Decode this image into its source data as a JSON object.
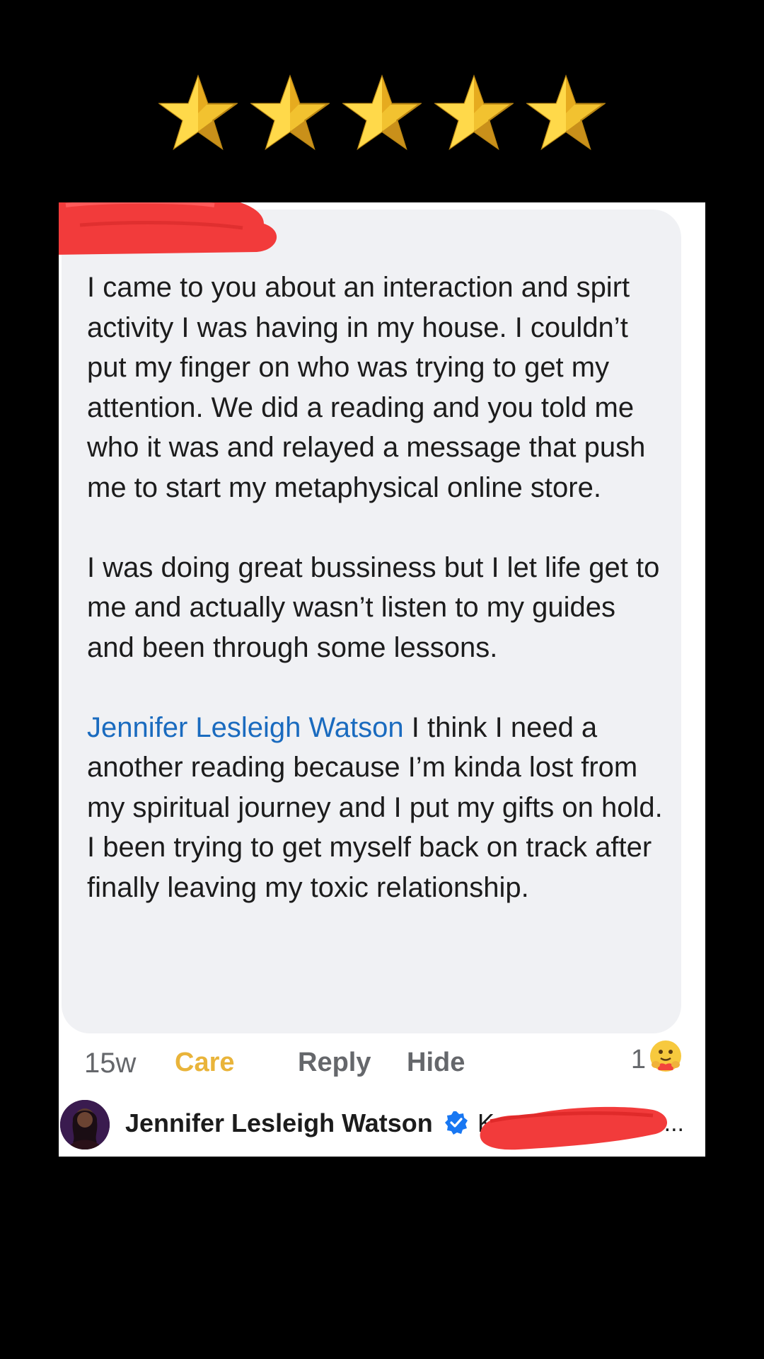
{
  "rating": {
    "stars": 5,
    "max": 5,
    "icon": "star-icon",
    "color": "#f2c230"
  },
  "comment": {
    "paragraph_1": "I came to you about an interaction and spirt activity I was having in my house. I couldn’t put my finger on who was trying to get my attention. We did a reading and you told me who it was and relayed a message that push me to start my metaphysical online store.",
    "paragraph_2": "I was doing great bussiness but I let life get to me and actually wasn’t listen to my guides and been through some lessons.",
    "mention": "Jennifer Lesleigh Watson",
    "paragraph_3": " I think I need a another reading because I’m kinda lost from my spiritual journey and I put my gifts on hold. I been trying to get myself back on track after finally leaving my toxic relationship."
  },
  "actions": {
    "time": "15w",
    "care": "Care",
    "reply": "Reply",
    "hide": "Hide",
    "reaction_count": "1",
    "reaction_icon": "care-emoji-icon"
  },
  "reply": {
    "name": "Jennifer Lesleigh Watson",
    "snippet": "K",
    "ellipsis": "...",
    "verified_icon": "verified-badge-icon"
  },
  "colors": {
    "mention": "#1a6bbf",
    "care": "#e9b43a",
    "redaction": "#f23b3b",
    "verified": "#1877f2"
  }
}
